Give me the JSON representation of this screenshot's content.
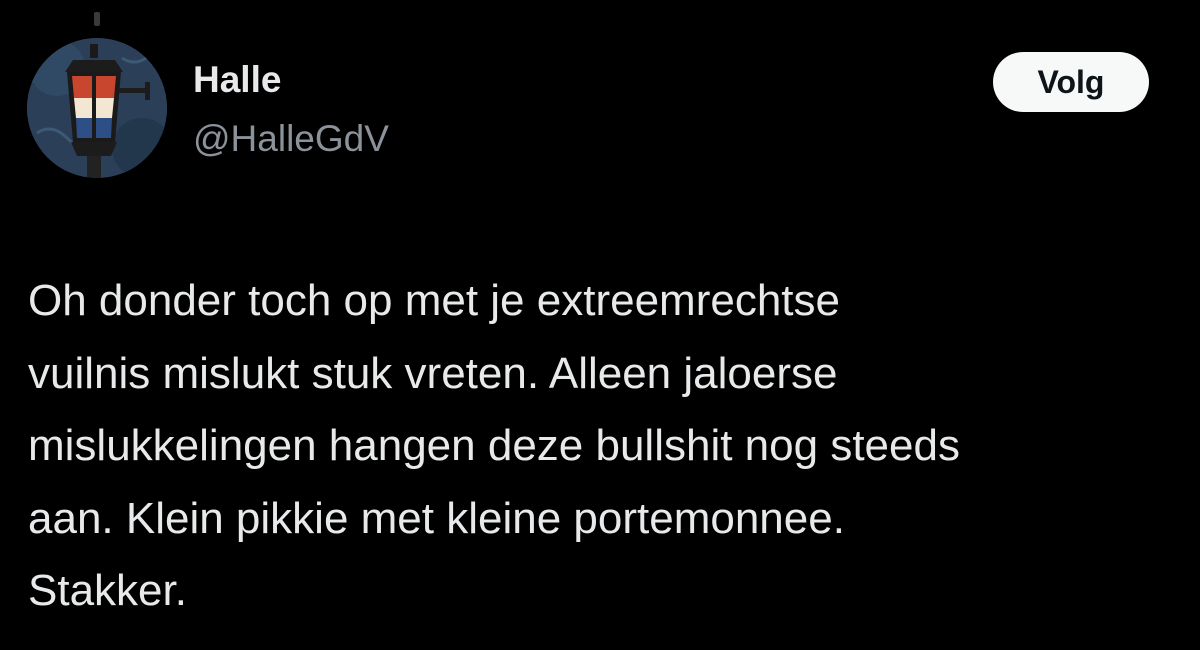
{
  "author": {
    "display_name": "Halle",
    "handle": "@HalleGdV",
    "avatar_icon": "lantern-avatar-icon"
  },
  "actions": {
    "follow_label": "Volg"
  },
  "tweet": {
    "lines": [
      "Oh donder toch op met je extreemrechtse",
      "vuilnis mislukt stuk vreten. Alleen jaloerse",
      "mislukkelingen hangen deze bullshit nog steeds",
      "aan. Klein pikkie met kleine portemonnee.",
      "Stakker."
    ]
  },
  "colors": {
    "background": "#000000",
    "primary_text": "#e7e9ea",
    "secondary_text": "#8b9299",
    "follow_button_bg": "#f7f9f9",
    "follow_button_text": "#0f1419"
  }
}
